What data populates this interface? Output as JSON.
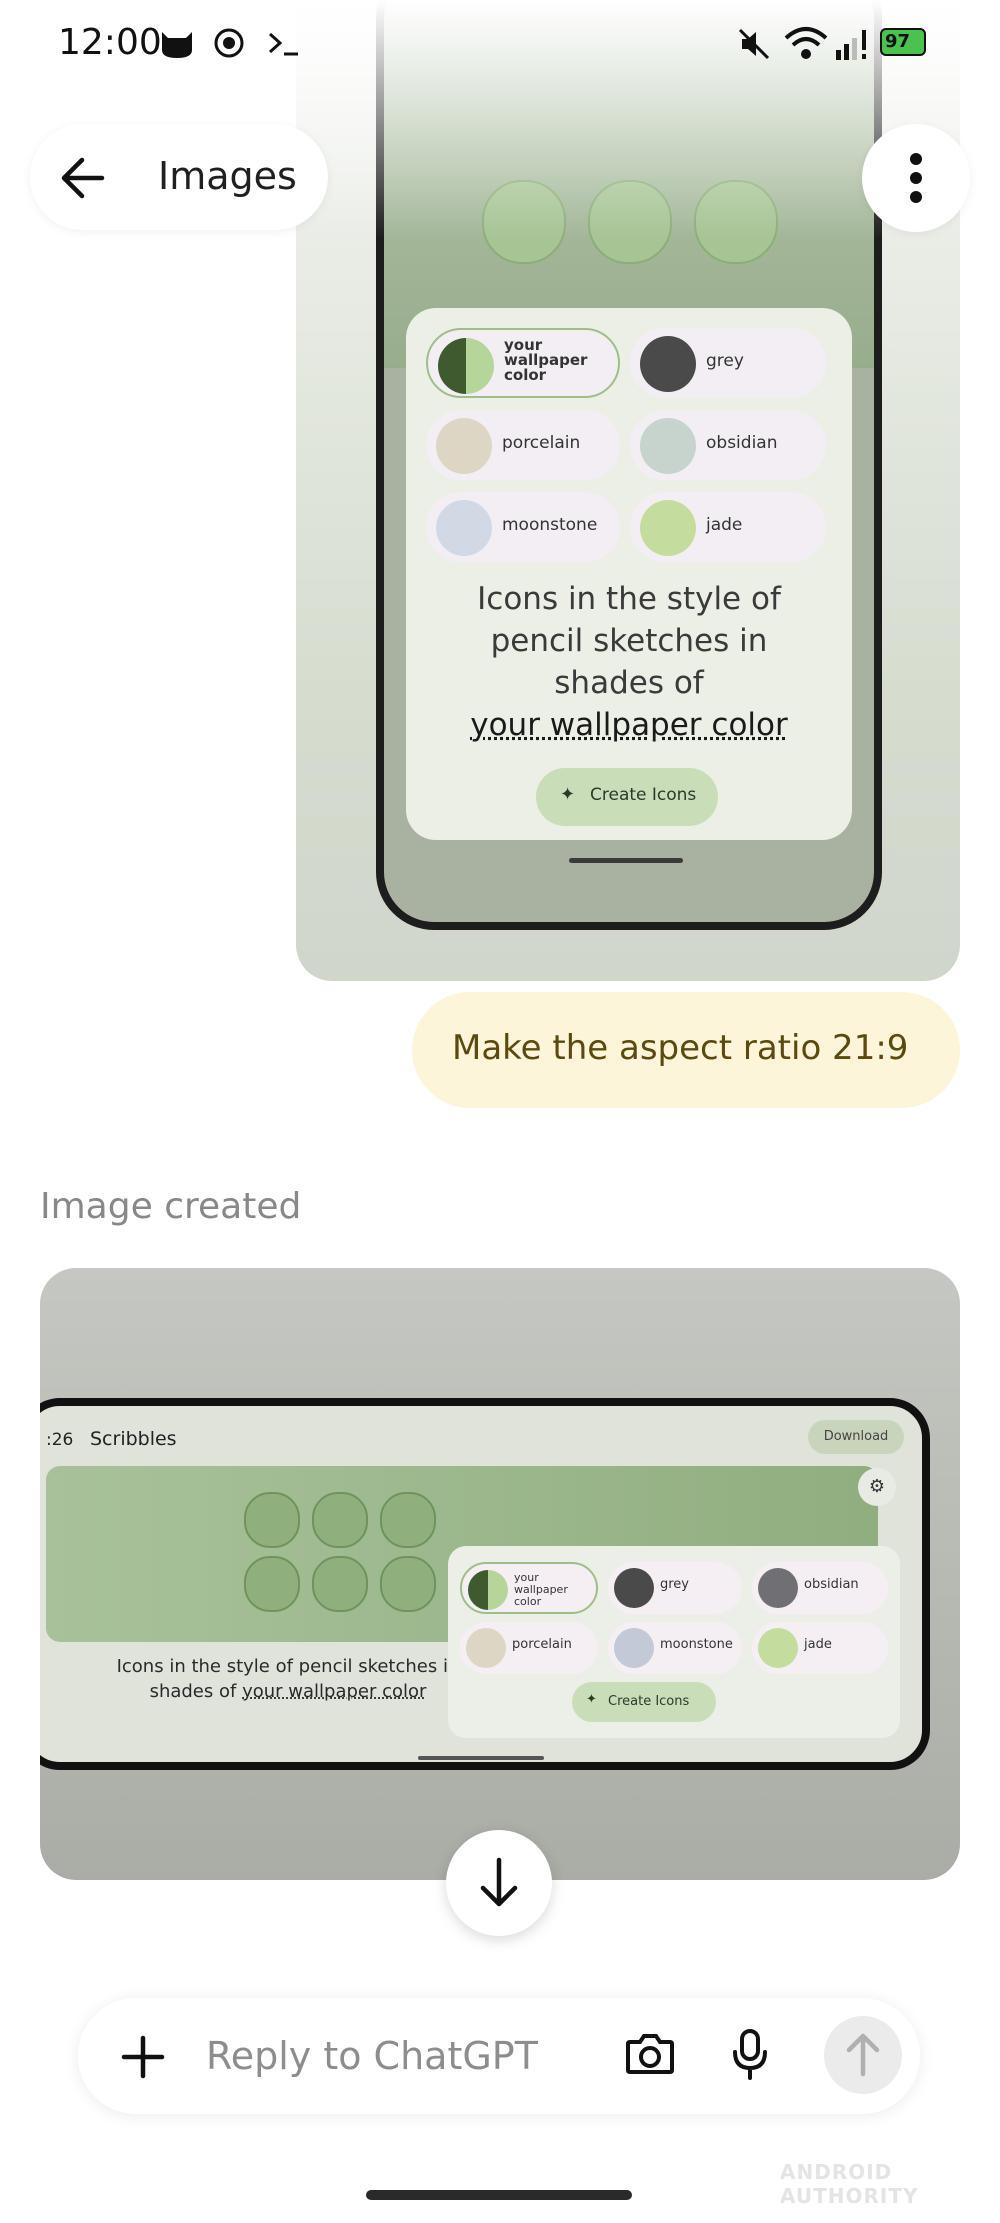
{
  "status_bar": {
    "time": "12:00",
    "battery": "97"
  },
  "header": {
    "title": "Images"
  },
  "image1": {
    "options": [
      {
        "label": "your wallpaper color",
        "color": "#3f5a2f"
      },
      {
        "label": "grey",
        "color": "#4a4a4a"
      },
      {
        "label": "porcelain",
        "color": "#ddd6c4"
      },
      {
        "label": "obsidian",
        "color": "#c7d3cd"
      },
      {
        "label": "moonstone",
        "color": "#d1d9e4"
      },
      {
        "label": "jade",
        "color": "#c4dd9e"
      }
    ],
    "desc_line1": "Icons in the style of",
    "desc_line2": "pencil sketches in",
    "desc_line3": "shades of",
    "desc_strong": "your wallpaper color",
    "create_label": "Create Icons"
  },
  "user_message": "Make the aspect ratio 21:9",
  "image_created_label": "Image created",
  "image2": {
    "time": ":26",
    "app_name": "Scribbles",
    "download_label": "Download",
    "options": [
      {
        "label": "your wallpaper color",
        "color": "#3f5a2f"
      },
      {
        "label": "grey",
        "color": "#4a4a4a"
      },
      {
        "label": "obsidian",
        "color": "#6f6f74"
      },
      {
        "label": "porcelain",
        "color": "#ddd6c4"
      },
      {
        "label": "moonstone",
        "color": "#c3c9d6"
      },
      {
        "label": "jade",
        "color": "#c4dd9e"
      }
    ],
    "desc_prefix": "Icons in the style of pencil sketches in shades of ",
    "desc_strong": "your wallpaper color",
    "create_label": "Create Icons"
  },
  "composer": {
    "placeholder": "Reply to ChatGPT"
  },
  "watermark": "ANDROID AUTHORITY"
}
